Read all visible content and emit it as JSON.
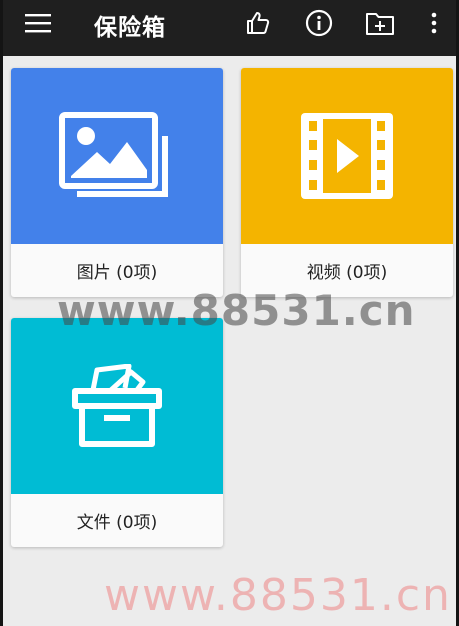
{
  "app_bar": {
    "title": "保险箱",
    "icons": [
      "menu-icon",
      "thumbs-up-icon",
      "info-icon",
      "new-folder-icon",
      "more-vert-icon"
    ]
  },
  "cards": {
    "photos": {
      "label": "图片 (0项)",
      "color": "#4381ea",
      "icon": "image-gallery-icon"
    },
    "videos": {
      "label": "视频 (0项)",
      "color": "#f4b400",
      "icon": "film-play-icon"
    },
    "files": {
      "label": "文件 (0项)",
      "color": "#00bcd4",
      "icon": "file-box-icon"
    }
  },
  "watermarks": {
    "middle": "www.88531.cn",
    "bottom": "www.88531.cn"
  }
}
